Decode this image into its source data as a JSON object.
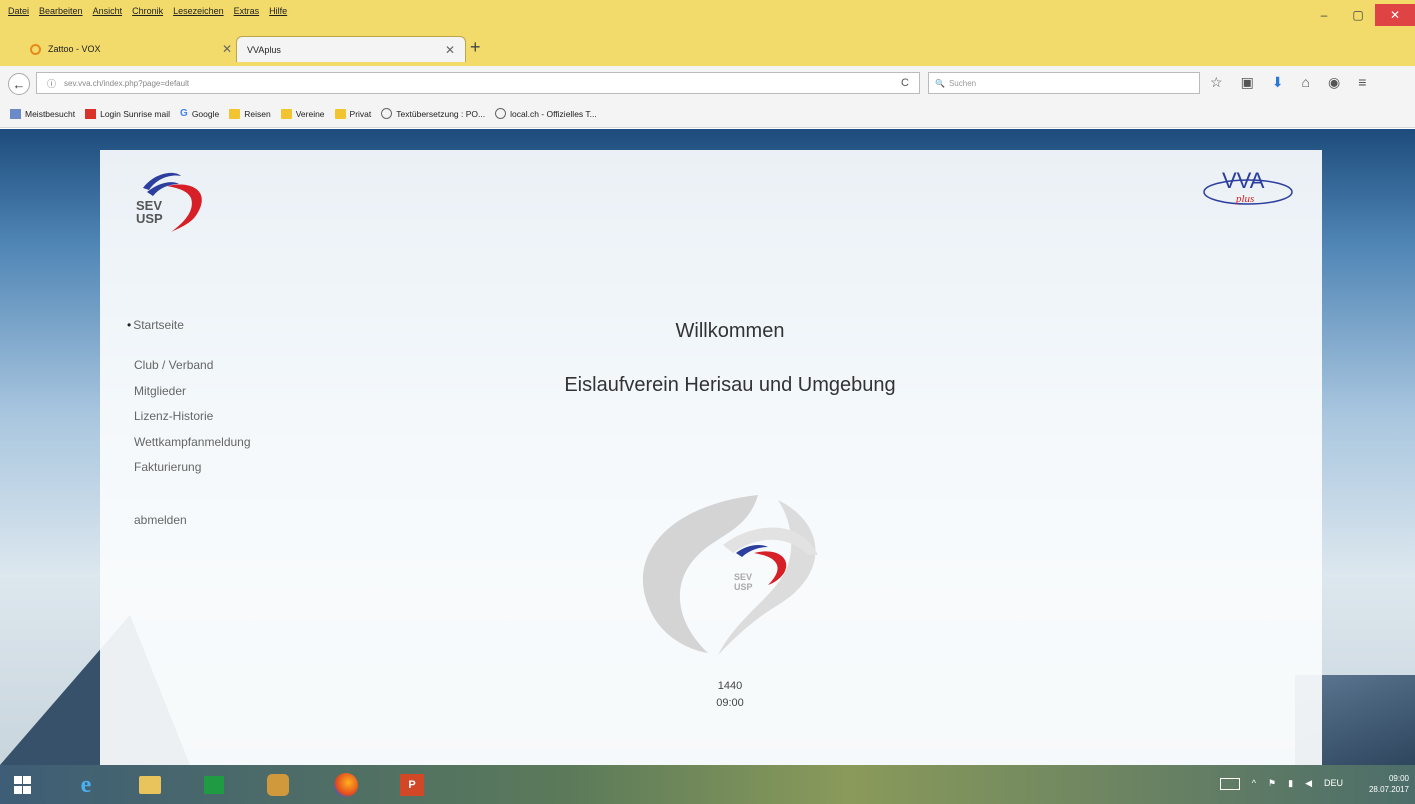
{
  "menu": [
    "Datei",
    "Bearbeiten",
    "Ansicht",
    "Chronik",
    "Lesezeichen",
    "Extras",
    "Hilfe"
  ],
  "window_controls": {
    "minimize": "–",
    "maximize": "▢",
    "close": "✕"
  },
  "tabs": [
    {
      "title": "Zattoo - VOX",
      "close": "✕"
    },
    {
      "title": "VVAplus",
      "close": "✕"
    }
  ],
  "new_tab": "+",
  "navbar": {
    "back": "←",
    "info": "ⓘ",
    "url": "sev.vva.ch/index.php?page=default",
    "reload": "C",
    "search_placeholder": "Suchen"
  },
  "bookmarks": [
    {
      "label": "Meistbesucht",
      "icon": "blue"
    },
    {
      "label": "Login Sunrise mail",
      "icon": "red"
    },
    {
      "label": "Google",
      "icon": "g"
    },
    {
      "label": "Reisen",
      "icon": "folder"
    },
    {
      "label": "Vereine",
      "icon": "folder"
    },
    {
      "label": "Privat",
      "icon": "folder"
    },
    {
      "label": "Textübersetzung : PO...",
      "icon": "globe"
    },
    {
      "label": "local.ch - Offizielles T...",
      "icon": "globe"
    }
  ],
  "logo": {
    "sev_line1": "SEV",
    "sev_line2": "USP"
  },
  "sidebar": {
    "items": [
      "Startseite",
      "Club / Verband",
      "Mitglieder",
      "Lizenz-Historie",
      "Wettkampfanmeldung",
      "Fakturierung",
      "abmelden"
    ],
    "active": "Startseite"
  },
  "main": {
    "welcome": "Willkommen",
    "club_name": "Eislaufverein Herisau und Umgebung",
    "emblem_text1": "SEV",
    "emblem_text2": "USP",
    "counter": "1440",
    "time": "09:00"
  },
  "taskbar": {
    "ppt_label": "P",
    "tray_lang": "DEU",
    "clock_time": "09:00",
    "clock_date": "28.07.2017"
  },
  "colors": {
    "titlebar": "#f2db6b",
    "logo_blue": "#2c3e9e",
    "logo_red": "#d61f26"
  }
}
